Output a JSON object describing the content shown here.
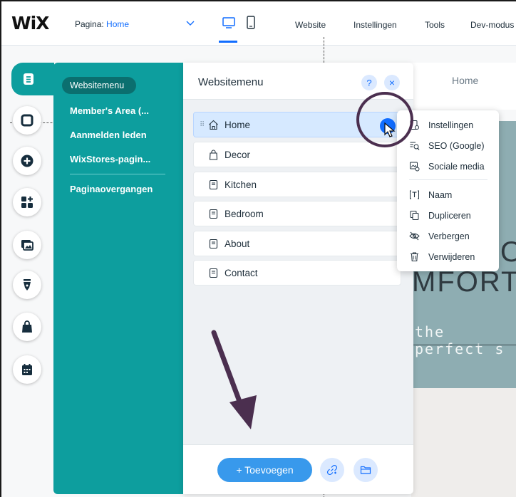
{
  "topbar": {
    "logo": "WiX",
    "page_prefix": "Pagina: ",
    "page_value": "Home",
    "menu": [
      "Website",
      "Instellingen",
      "Tools",
      "Dev-modus"
    ]
  },
  "site_preview": {
    "nav_home": "Home",
    "hero_o": "O",
    "hero_text": "MFORT",
    "hero_sub": "the perfect s"
  },
  "left_rail": {
    "icons": [
      "pages-icon",
      "background-icon",
      "add-icon",
      "apps-icon",
      "media-icon",
      "blog-icon",
      "store-icon",
      "bookings-icon"
    ]
  },
  "teal_panel": {
    "items": [
      "Websitemenu",
      "Member's Area (...",
      "Aanmelden leden",
      "WixStores-pagin...",
      "Paginaovergangen"
    ]
  },
  "pages_panel": {
    "title": "Websitemenu",
    "help": "?",
    "close": "×",
    "pages": [
      {
        "label": "Home",
        "icon": "home-icon"
      },
      {
        "label": "Decor",
        "icon": "bag-icon"
      },
      {
        "label": "Kitchen",
        "icon": "page-icon"
      },
      {
        "label": "Bedroom",
        "icon": "page-icon"
      },
      {
        "label": "About",
        "icon": "page-icon"
      },
      {
        "label": "Contact",
        "icon": "page-icon"
      }
    ],
    "add_button": "+ Toevoegen"
  },
  "context_menu": {
    "items": [
      "Instellingen",
      "SEO (Google)",
      "Sociale media",
      "Naam",
      "Dupliceren",
      "Verbergen",
      "Verwijderen"
    ]
  },
  "colors": {
    "teal": "#0d9e9e",
    "accent_blue": "#116dff",
    "annotation": "#4b2f4f"
  }
}
